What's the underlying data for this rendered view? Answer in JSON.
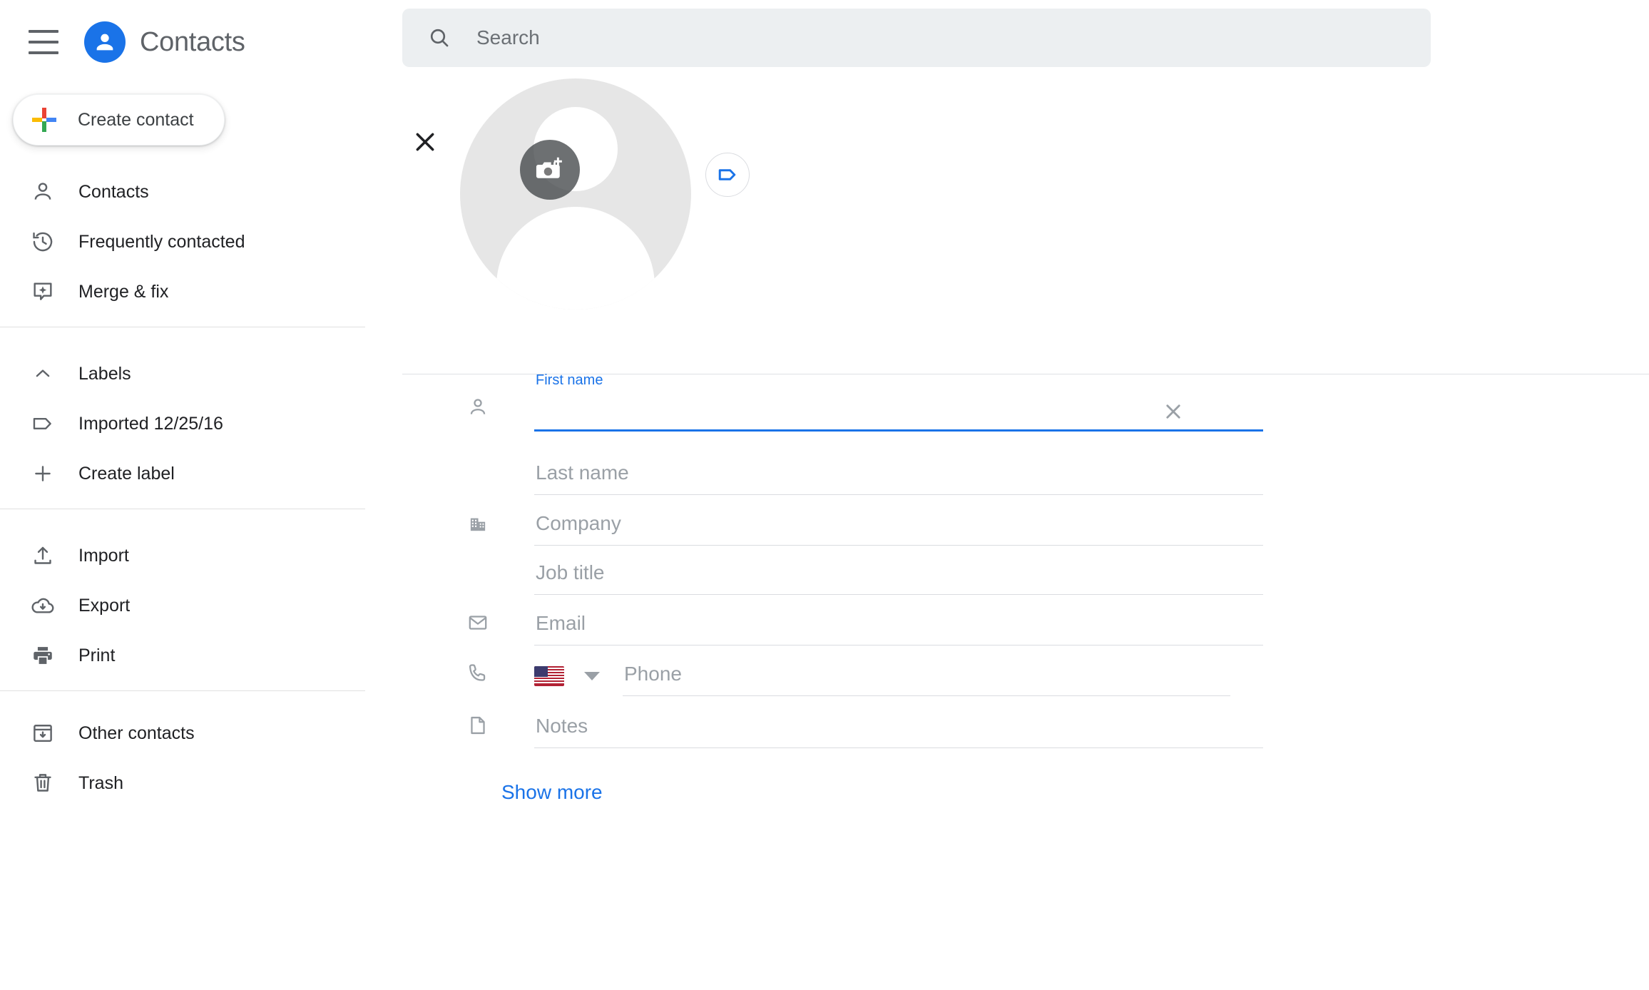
{
  "app": {
    "title": "Contacts",
    "accent_blue": "#1a73e8",
    "text_gray": "#202124",
    "placeholder_gray": "#9aa0a6"
  },
  "header": {
    "menu_icon": "hamburger-menu-icon",
    "logo_icon": "contacts-person-logo-icon",
    "title": "Contacts"
  },
  "search": {
    "icon": "search-icon",
    "placeholder": "Search",
    "value": ""
  },
  "sidebar": {
    "create_button": {
      "label": "Create contact",
      "icon": "google-plus-icon"
    },
    "groups": [
      {
        "items": [
          {
            "label": "Contacts",
            "icon": "person-icon"
          },
          {
            "label": "Frequently contacted",
            "icon": "history-clock-icon"
          },
          {
            "label": "Merge & fix",
            "icon": "merge-sparkle-icon"
          }
        ]
      },
      {
        "items": [
          {
            "label": "Labels",
            "icon": "chevron-up-icon"
          },
          {
            "label": "Imported 12/25/16",
            "icon": "tag-icon"
          },
          {
            "label": "Create label",
            "icon": "plus-icon"
          }
        ]
      },
      {
        "items": [
          {
            "label": "Import",
            "icon": "upload-icon"
          },
          {
            "label": "Export",
            "icon": "cloud-download-icon"
          },
          {
            "label": "Print",
            "icon": "printer-icon"
          }
        ]
      },
      {
        "items": [
          {
            "label": "Other contacts",
            "icon": "archive-down-icon"
          },
          {
            "label": "Trash",
            "icon": "trash-icon"
          }
        ]
      }
    ]
  },
  "editor": {
    "close_icon": "close-x-icon",
    "avatar": {
      "icon": "default-person-avatar-icon",
      "camera_button_icon": "add-photo-camera-icon"
    },
    "label_button": {
      "icon": "label-tag-icon"
    },
    "fields": [
      {
        "name": "first_name",
        "icon": "person-icon",
        "label": "First name",
        "placeholder": "",
        "value": "",
        "focused": true,
        "has_clear": true,
        "clear_icon": "clear-x-icon"
      },
      {
        "name": "last_name",
        "icon": "",
        "label": "",
        "placeholder": "Last name",
        "value": "",
        "focused": false,
        "has_clear": false
      },
      {
        "name": "company",
        "icon": "building-icon",
        "label": "",
        "placeholder": "Company",
        "value": "",
        "focused": false,
        "has_clear": false
      },
      {
        "name": "job_title",
        "icon": "",
        "label": "",
        "placeholder": "Job title",
        "value": "",
        "focused": false,
        "has_clear": false
      },
      {
        "name": "email",
        "icon": "envelope-icon",
        "label": "",
        "placeholder": "Email",
        "value": "",
        "focused": false,
        "has_clear": false
      },
      {
        "name": "phone",
        "icon": "phone-handset-icon",
        "label": "",
        "placeholder": "Phone",
        "value": "",
        "focused": false,
        "has_clear": false,
        "country_flag": "us-flag-icon",
        "country_caret_icon": "caret-down-icon"
      },
      {
        "name": "notes",
        "icon": "note-page-icon",
        "label": "",
        "placeholder": "Notes",
        "value": "",
        "focused": false,
        "has_clear": false
      }
    ],
    "show_more_label": "Show more"
  }
}
